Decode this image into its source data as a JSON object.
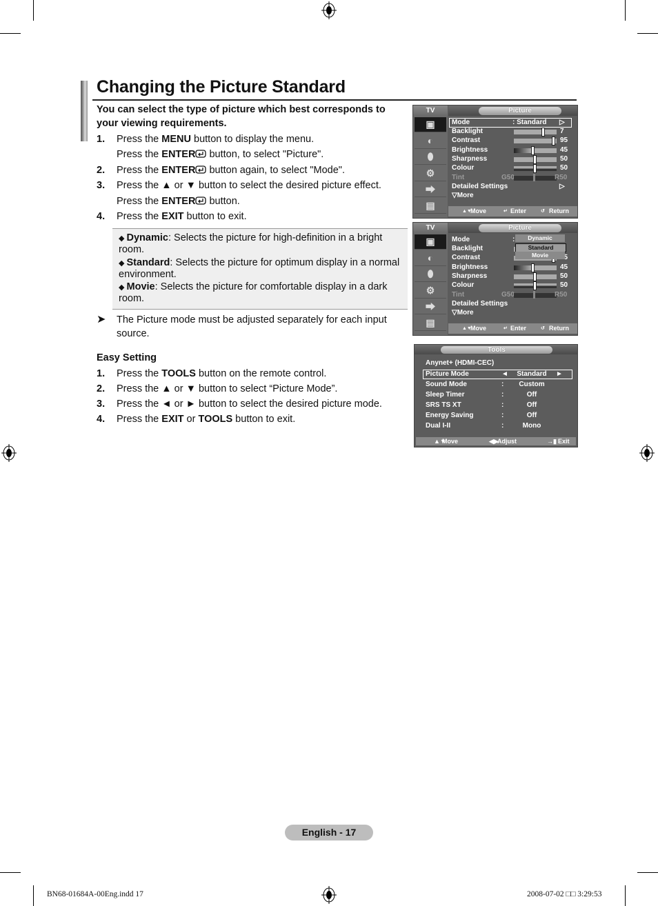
{
  "page": {
    "title": "Changing the Picture Standard",
    "intro": "You can select the type of picture which best corresponds to your viewing requirements.",
    "steps": [
      {
        "num": "1.",
        "pre": "Press the ",
        "bold": "MENU",
        "post": " button to display the menu."
      },
      {
        "num": "",
        "pre": "Press the ",
        "bold": "ENTER",
        "icon": "enter-icon",
        "post": " button, to select \"Picture\"."
      },
      {
        "num": "2.",
        "pre": "Press the ",
        "bold": "ENTER",
        "icon": "enter-icon",
        "post": " button again, to select \"Mode\"."
      },
      {
        "num": "3.",
        "pre": "Press the ▲ or ▼ button to select the desired picture effect.",
        "bold": "",
        "post": ""
      },
      {
        "num": "",
        "pre": "Press the ",
        "bold": "ENTER",
        "icon": "enter-icon",
        "post": " button."
      },
      {
        "num": "4.",
        "pre": "Press the ",
        "bold": "EXIT",
        "post": " button to exit."
      }
    ],
    "bullets": [
      {
        "term": "Dynamic",
        "text": ": Selects the picture for high-definition in a bright room."
      },
      {
        "term": "Standard",
        "text": ": Selects the picture for optimum display in a normal environment."
      },
      {
        "term": "Movie",
        "text": ": Selects the picture for comfortable display in a dark room."
      }
    ],
    "note": "The Picture mode must be adjusted separately for each input source.",
    "easy_setting": {
      "heading": "Easy Setting",
      "steps": [
        {
          "num": "1.",
          "pre": "Press the ",
          "bold": "TOOLS",
          "mid": " button on the remote control.",
          "bold2": "",
          "post": ""
        },
        {
          "num": "2.",
          "pre": "Press the ▲ or ▼ button to select “Picture Mode”.",
          "bold": "",
          "mid": "",
          "bold2": "",
          "post": ""
        },
        {
          "num": "3.",
          "pre": "Press the ◄ or ► button to select the desired picture mode.",
          "bold": "",
          "mid": "",
          "bold2": "",
          "post": ""
        },
        {
          "num": "4.",
          "pre": "Press the ",
          "bold": "EXIT",
          "mid": " or ",
          "bold2": "TOOLS",
          "post": " button to exit."
        }
      ]
    },
    "footer_page": "English - 17",
    "slug_left": "BN68-01684A-00Eng.indd   17",
    "slug_right": "2008-07-02   □□ 3:29:53"
  },
  "osd_picture": {
    "tv_label": "TV",
    "header": "Picture",
    "mode_label": "Mode",
    "mode_value": ": Standard",
    "rows": [
      {
        "label": "Backlight",
        "value": "7",
        "level": 0.7
      },
      {
        "label": "Contrast",
        "value": "95",
        "level": 0.95
      },
      {
        "label": "Brightness",
        "value": "45",
        "level": 0.45
      },
      {
        "label": "Sharpness",
        "value": "50",
        "level": 0.5
      },
      {
        "label": "Colour",
        "value": "50",
        "level": 0.5
      }
    ],
    "tint": {
      "label": "Tint",
      "left": "G50",
      "right": "R50",
      "level": 0.5
    },
    "detailed": "Detailed Settings",
    "more": "▽More",
    "footer": {
      "move": "Move",
      "enter": "Enter",
      "return": "Return"
    }
  },
  "osd_mode_dropdown": {
    "options": [
      "Dynamic",
      "Standard",
      "Movie"
    ],
    "selected": "Standard"
  },
  "tools_menu": {
    "header": "Tools",
    "anynet": "Anynet+ (HDMI-CEC)",
    "rows": [
      {
        "label": "Picture Mode",
        "value": "Standard",
        "selected": true
      },
      {
        "label": "Sound Mode",
        "value": "Custom"
      },
      {
        "label": "Sleep Timer",
        "value": "Off"
      },
      {
        "label": "SRS TS XT",
        "value": "Off"
      },
      {
        "label": "Energy Saving",
        "value": "Off"
      },
      {
        "label": "Dual I-II",
        "value": "Mono"
      }
    ],
    "footer": {
      "move": "Move",
      "adjust": "Adjust",
      "exit": "Exit"
    }
  }
}
